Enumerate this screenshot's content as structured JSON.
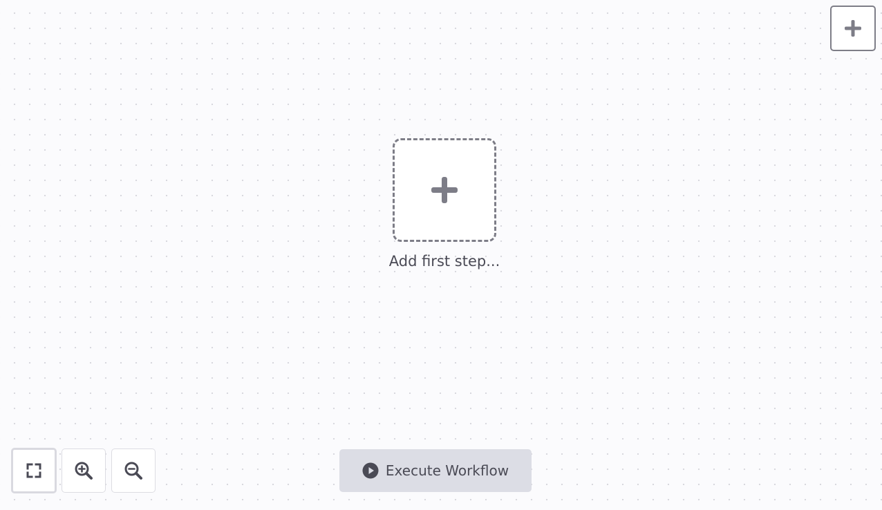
{
  "canvas": {
    "top_add_button": {
      "icon": "plus-icon"
    },
    "first_step": {
      "icon": "plus-icon",
      "label": "Add first step..."
    },
    "zoom_controls": {
      "fit_view_icon": "fit-view-icon",
      "zoom_in_icon": "zoom-in-icon",
      "zoom_out_icon": "zoom-out-icon"
    },
    "execute": {
      "icon": "play-circle-icon",
      "label": "Execute Workflow"
    }
  },
  "colors": {
    "canvas_background": "#fbfbfd",
    "grid_dot": "#d6d6dc",
    "icon_gray": "#7d7d87",
    "text_dark": "#4a4a55",
    "execute_background": "#dcdde5"
  }
}
